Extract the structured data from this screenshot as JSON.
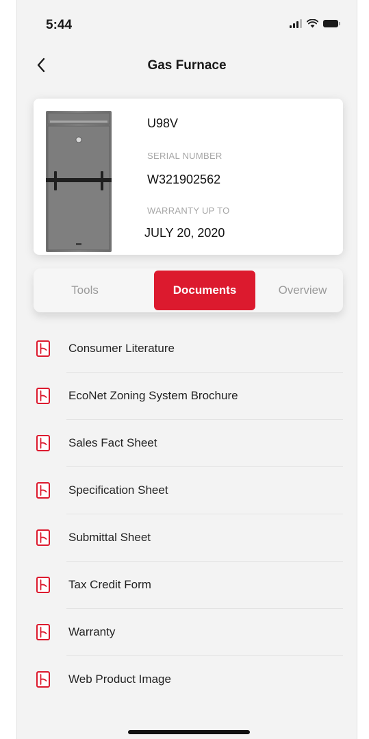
{
  "status_bar": {
    "time": "5:44",
    "icons": [
      "signal-icon",
      "wifi-icon",
      "battery-icon"
    ]
  },
  "nav": {
    "back_icon": "chevron-left-icon",
    "title": "Gas Furnace"
  },
  "product": {
    "image_icon": "furnace-image",
    "model": "U98V",
    "serial_label": "SERIAL NUMBER",
    "serial_value": "W321902562",
    "warranty_label": "WARRANTY UP TO",
    "warranty_value": "JULY 20, 2020"
  },
  "tabs": [
    {
      "label": "Tools",
      "active": false
    },
    {
      "label": "Documents",
      "active": true
    },
    {
      "label": "Overview",
      "active": false
    }
  ],
  "documents": {
    "icon": "pdf-icon",
    "items": [
      {
        "label": "Consumer Literature"
      },
      {
        "label": "EcoNet Zoning System Brochure"
      },
      {
        "label": "Sales Fact Sheet"
      },
      {
        "label": "Specification Sheet"
      },
      {
        "label": "Submittal Sheet"
      },
      {
        "label": "Tax Credit Form"
      },
      {
        "label": "Warranty"
      },
      {
        "label": "Web Product Image"
      }
    ]
  },
  "colors": {
    "accent": "#dc1a2e",
    "background": "#f3f3f3",
    "card": "#ffffff",
    "muted_text": "#a6a6a6"
  }
}
